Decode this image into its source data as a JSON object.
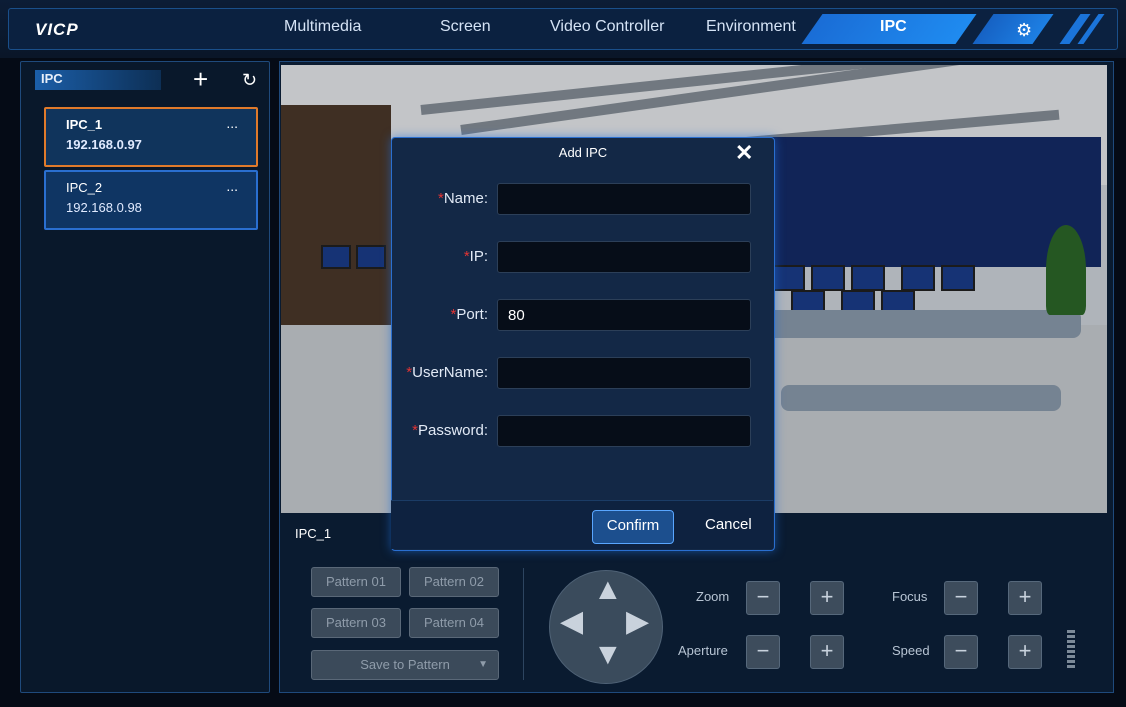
{
  "app": {
    "logo": "VICP"
  },
  "nav": {
    "tabs": [
      {
        "label": "Multimedia"
      },
      {
        "label": "Screen"
      },
      {
        "label": "Video Controller"
      },
      {
        "label": "Environment"
      },
      {
        "label": "IPC"
      }
    ],
    "active": "IPC"
  },
  "sidebar": {
    "title": "IPC",
    "items": [
      {
        "name": "IPC_1",
        "ip": "192.168.0.97",
        "menu": "..."
      },
      {
        "name": "IPC_2",
        "ip": "192.168.0.98",
        "menu": "..."
      }
    ]
  },
  "controls": {
    "camera_label": "IPC_1",
    "patterns": [
      "Pattern 01",
      "Pattern 02",
      "Pattern 03",
      "Pattern 04"
    ],
    "save_pattern": "Save to Pattern",
    "zoom": "Zoom",
    "focus": "Focus",
    "aperture": "Aperture",
    "speed": "Speed",
    "minus": "−",
    "plus": "+"
  },
  "dialog": {
    "title": "Add IPC",
    "fields": {
      "name": {
        "label": "Name:",
        "value": ""
      },
      "ip": {
        "label": "IP:",
        "value": ""
      },
      "port": {
        "label": "Port:",
        "value": "80"
      },
      "username": {
        "label": "UserName:",
        "value": ""
      },
      "password": {
        "label": "Password:",
        "value": ""
      }
    },
    "required_mark": "*",
    "confirm": "Confirm",
    "cancel": "Cancel"
  },
  "colors": {
    "accent": "#1f8bf0",
    "selected_border": "#e07a2b",
    "required": "#e23434"
  }
}
